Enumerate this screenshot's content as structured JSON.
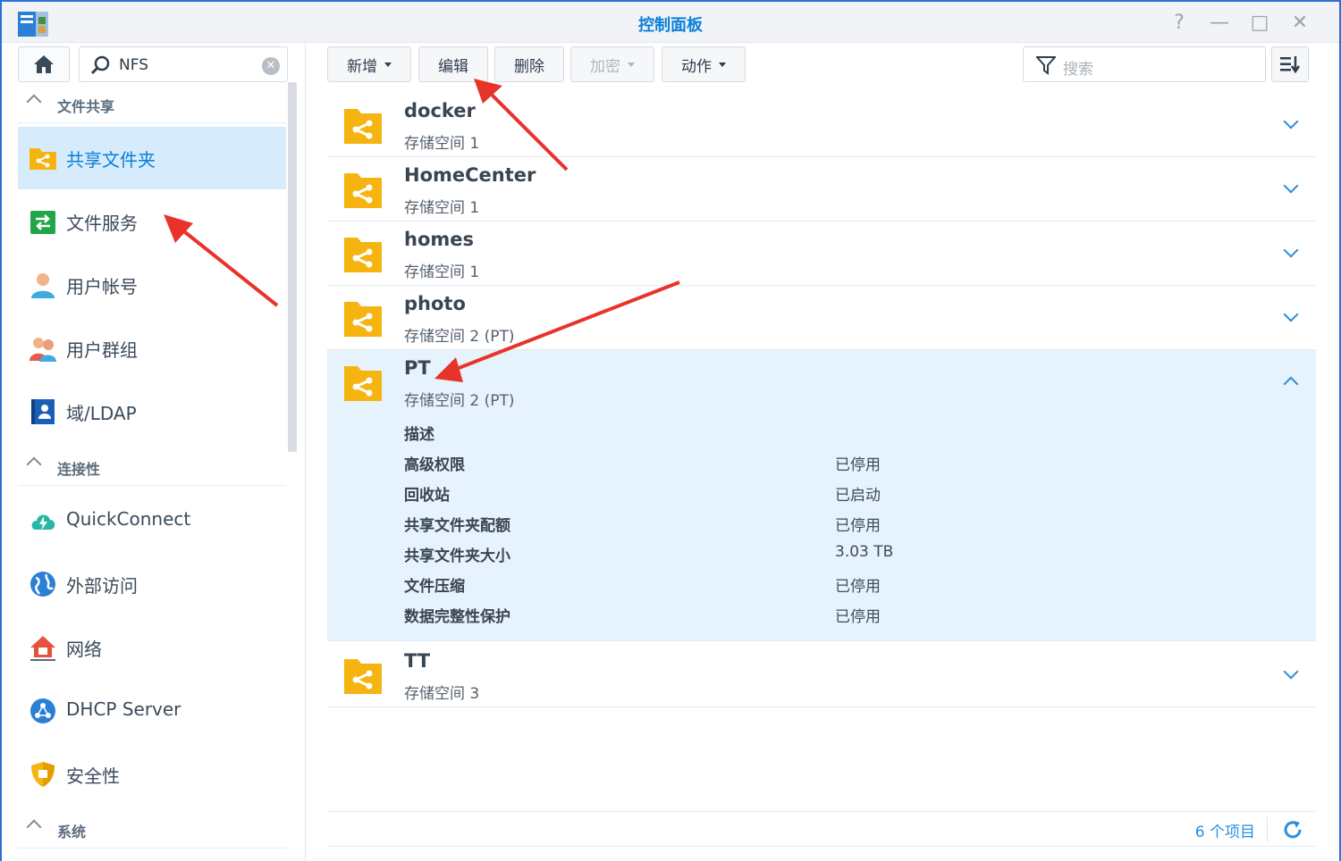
{
  "window": {
    "title": "控制面板",
    "controls": [
      "?",
      "—",
      "□",
      "✕"
    ]
  },
  "sidebar": {
    "search_value": "NFS",
    "sections": [
      {
        "label": "文件共享"
      },
      {
        "label": "连接性"
      },
      {
        "label": "系统"
      }
    ],
    "items": [
      {
        "label": "共享文件夹",
        "icon": "shared-folder-icon",
        "active": true
      },
      {
        "label": "文件服务",
        "icon": "file-services-icon"
      },
      {
        "label": "用户帐号",
        "icon": "user-account-icon"
      },
      {
        "label": "用户群组",
        "icon": "user-group-icon"
      },
      {
        "label": "域/LDAP",
        "icon": "ldap-icon"
      },
      {
        "label": "QuickConnect",
        "icon": "quickconnect-icon"
      },
      {
        "label": "外部访问",
        "icon": "external-access-icon"
      },
      {
        "label": "网络",
        "icon": "network-icon"
      },
      {
        "label": "DHCP Server",
        "icon": "dhcp-server-icon"
      },
      {
        "label": "安全性",
        "icon": "security-icon"
      }
    ]
  },
  "toolbar": {
    "create": "新增",
    "edit": "编辑",
    "delete": "删除",
    "encrypt": "加密",
    "action": "动作",
    "search_placeholder": "搜索"
  },
  "folders": [
    {
      "name": "docker",
      "volume": "存储空间 1"
    },
    {
      "name": "HomeCenter",
      "volume": "存储空间 1"
    },
    {
      "name": "homes",
      "volume": "存储空间 1"
    },
    {
      "name": "photo",
      "volume": "存储空间 2 (PT)"
    },
    {
      "name": "PT",
      "volume": "存储空间 2 (PT)",
      "expanded": true
    },
    {
      "name": "TT",
      "volume": "存储空间 3"
    }
  ],
  "details": [
    {
      "key": "描述",
      "value": ""
    },
    {
      "key": "高级权限",
      "value": "已停用"
    },
    {
      "key": "回收站",
      "value": "已启动"
    },
    {
      "key": "共享文件夹配额",
      "value": "已停用"
    },
    {
      "key": "共享文件夹大小",
      "value": "3.03 TB"
    },
    {
      "key": "文件压缩",
      "value": "已停用"
    },
    {
      "key": "数据完整性保护",
      "value": "已停用"
    }
  ],
  "footer": {
    "count": "6 个项目"
  },
  "colors": {
    "accent": "#0a7fd8",
    "folder": "#f5b40f",
    "selected_row": "#e6f2fc",
    "annotation_arrow": "#e8332b"
  }
}
